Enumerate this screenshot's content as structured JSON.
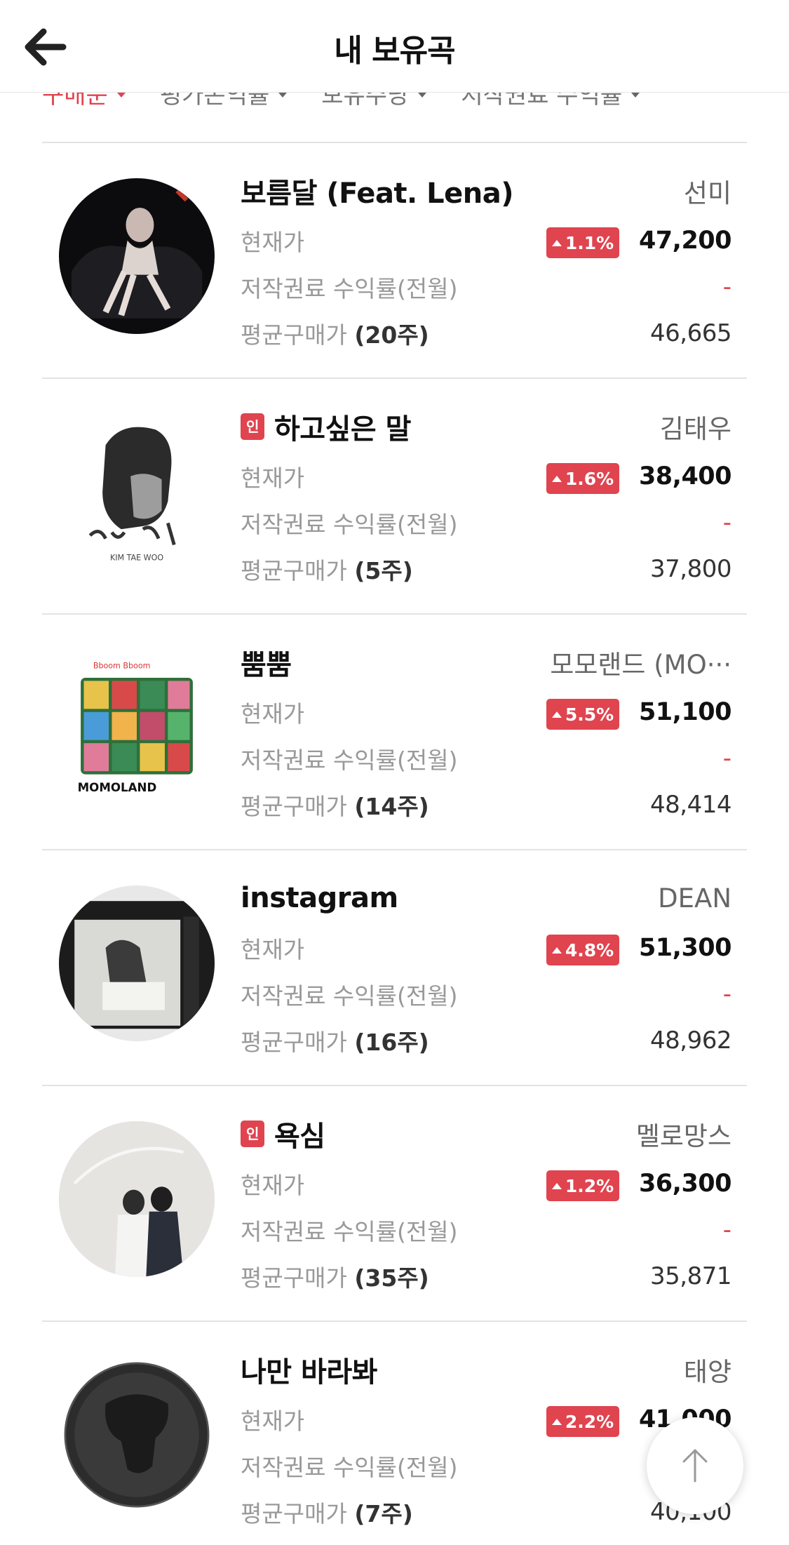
{
  "header": {
    "title": "내 보유곡"
  },
  "sort": [
    {
      "label": "구매순",
      "active": true
    },
    {
      "label": "평가손익률",
      "active": false
    },
    {
      "label": "보유주당",
      "active": false
    },
    {
      "label": "저작권료 수익률",
      "active": false
    }
  ],
  "labels": {
    "current_price": "현재가",
    "royalty_yield": "저작권료 수익률(전월)",
    "avg_price": "평균구매가"
  },
  "colors": {
    "accent": "#e0444f",
    "text": "#222222",
    "muted": "#999999"
  },
  "items": [
    {
      "title": "보름달 (Feat. Lena)",
      "artist": "선미",
      "badge_in": "",
      "change": "1.1%",
      "price": "47,200",
      "yield": "-",
      "shares": "(20주)",
      "avg": "46,665"
    },
    {
      "title": "하고싶은 말",
      "artist": "김태우",
      "badge_in": "인",
      "change": "1.6%",
      "price": "38,400",
      "yield": "-",
      "shares": "(5주)",
      "avg": "37,800"
    },
    {
      "title": "뿜뿜",
      "artist": "모모랜드 (MO···",
      "badge_in": "",
      "change": "5.5%",
      "price": "51,100",
      "yield": "-",
      "shares": "(14주)",
      "avg": "48,414"
    },
    {
      "title": "instagram",
      "artist": "DEAN",
      "badge_in": "",
      "change": "4.8%",
      "price": "51,300",
      "yield": "-",
      "shares": "(16주)",
      "avg": "48,962"
    },
    {
      "title": "욕심",
      "artist": "멜로망스",
      "badge_in": "인",
      "change": "1.2%",
      "price": "36,300",
      "yield": "-",
      "shares": "(35주)",
      "avg": "35,871"
    },
    {
      "title": "나만 바라봐",
      "artist": "태양",
      "badge_in": "",
      "change": "2.2%",
      "price": "41,000",
      "yield": "-",
      "shares": "(7주)",
      "avg": "40,100"
    }
  ]
}
